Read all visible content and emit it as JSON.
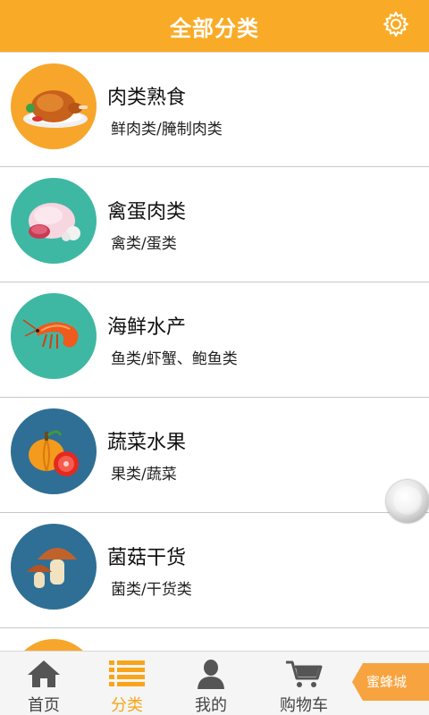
{
  "header": {
    "title": "全部分类",
    "settings_icon": "gear-icon",
    "color": "#f9ab27"
  },
  "categories": [
    {
      "title": "肉类熟食",
      "subtitle": "鲜肉类/腌制肉类",
      "icon": "roast-chicken-icon",
      "bg": "#f7a62b"
    },
    {
      "title": "禽蛋肉类",
      "subtitle": "禽类/蛋类",
      "icon": "ham-icon",
      "bg": "#3fb8a3"
    },
    {
      "title": "海鲜水产",
      "subtitle": "鱼类/虾蟹、鲍鱼类",
      "icon": "shrimp-icon",
      "bg": "#3fb8a3"
    },
    {
      "title": "蔬菜水果",
      "subtitle": "果类/蔬菜",
      "icon": "pumpkin-tomato-icon",
      "bg": "#2f6f95"
    },
    {
      "title": "菌菇干货",
      "subtitle": "菌类/干货类",
      "icon": "mushroom-icon",
      "bg": "#2f6f95"
    }
  ],
  "tabbar": {
    "tabs": [
      {
        "label": "首页",
        "icon": "home-icon",
        "active": false
      },
      {
        "label": "分类",
        "icon": "list-icon",
        "active": true
      },
      {
        "label": "我的",
        "icon": "user-icon",
        "active": false
      },
      {
        "label": "购物车",
        "icon": "cart-icon",
        "active": false
      }
    ],
    "active_color": "#f9a51a",
    "bee_button": "蜜蜂城"
  }
}
